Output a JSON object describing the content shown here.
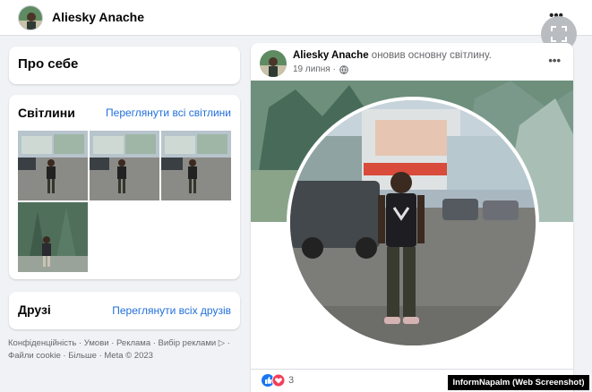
{
  "topbar": {
    "name": "Aliesky Anache",
    "more": "•••"
  },
  "sidebar": {
    "about_title": "Про себе",
    "photos_title": "Світлини",
    "photos_link": "Переглянути всі світлини",
    "friends_title": "Друзі",
    "friends_link": "Переглянути всіх друзів"
  },
  "footer": {
    "line1": "Конфіденційність · Умови · Реклама · Вибір реклами ▷ ·",
    "line2": "Файли cookie · Більше · Meta © 2023"
  },
  "post": {
    "author": "Aliesky Anache",
    "action": "оновив основну світлину.",
    "date": "19 липня ·",
    "more": "•••",
    "reaction_count": "3"
  },
  "watermark": "InformNapalm (Web Screenshot)",
  "colors": {
    "link": "#216fdb",
    "like": "#1877f2",
    "love": "#f33e58"
  },
  "icons": [
    "expand-icon",
    "globe-icon",
    "like-reaction-icon",
    "love-reaction-icon"
  ]
}
